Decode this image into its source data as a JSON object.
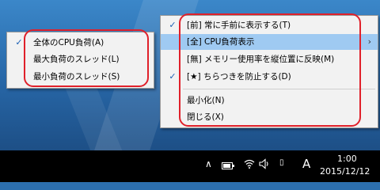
{
  "main_menu": {
    "items": [
      {
        "label": "[前] 常に手前に表示する(T)",
        "checked": true
      },
      {
        "label": "[全] CPU負荷表示",
        "checked": false,
        "highlighted": true,
        "submenu_arrow": "›"
      },
      {
        "label": "[無] メモリー使用率を縦位置に反映(M)",
        "checked": false
      },
      {
        "label": "[★] ちらつきを防止する(D)",
        "checked": true
      },
      {
        "label": "最小化(N)",
        "checked": false
      },
      {
        "label": "閉じる(X)",
        "checked": false
      }
    ]
  },
  "sub_menu": {
    "items": [
      {
        "label": "全体のCPU負荷(A)",
        "checked": true
      },
      {
        "label": "最大負荷のスレッド(L)",
        "checked": false
      },
      {
        "label": "最小負荷のスレッド(S)",
        "checked": false
      }
    ]
  },
  "check_glyph": "✓",
  "taskbar": {
    "tray_chevron": "∧",
    "ime_indicator": "ᐊ)",
    "language": "A",
    "clock_time": "1:00",
    "clock_date": "2015/12/12"
  },
  "colors": {
    "highlight": "#9fcaf2",
    "annotation": "#e0202a",
    "menu_bg": "#f2f2f2"
  }
}
